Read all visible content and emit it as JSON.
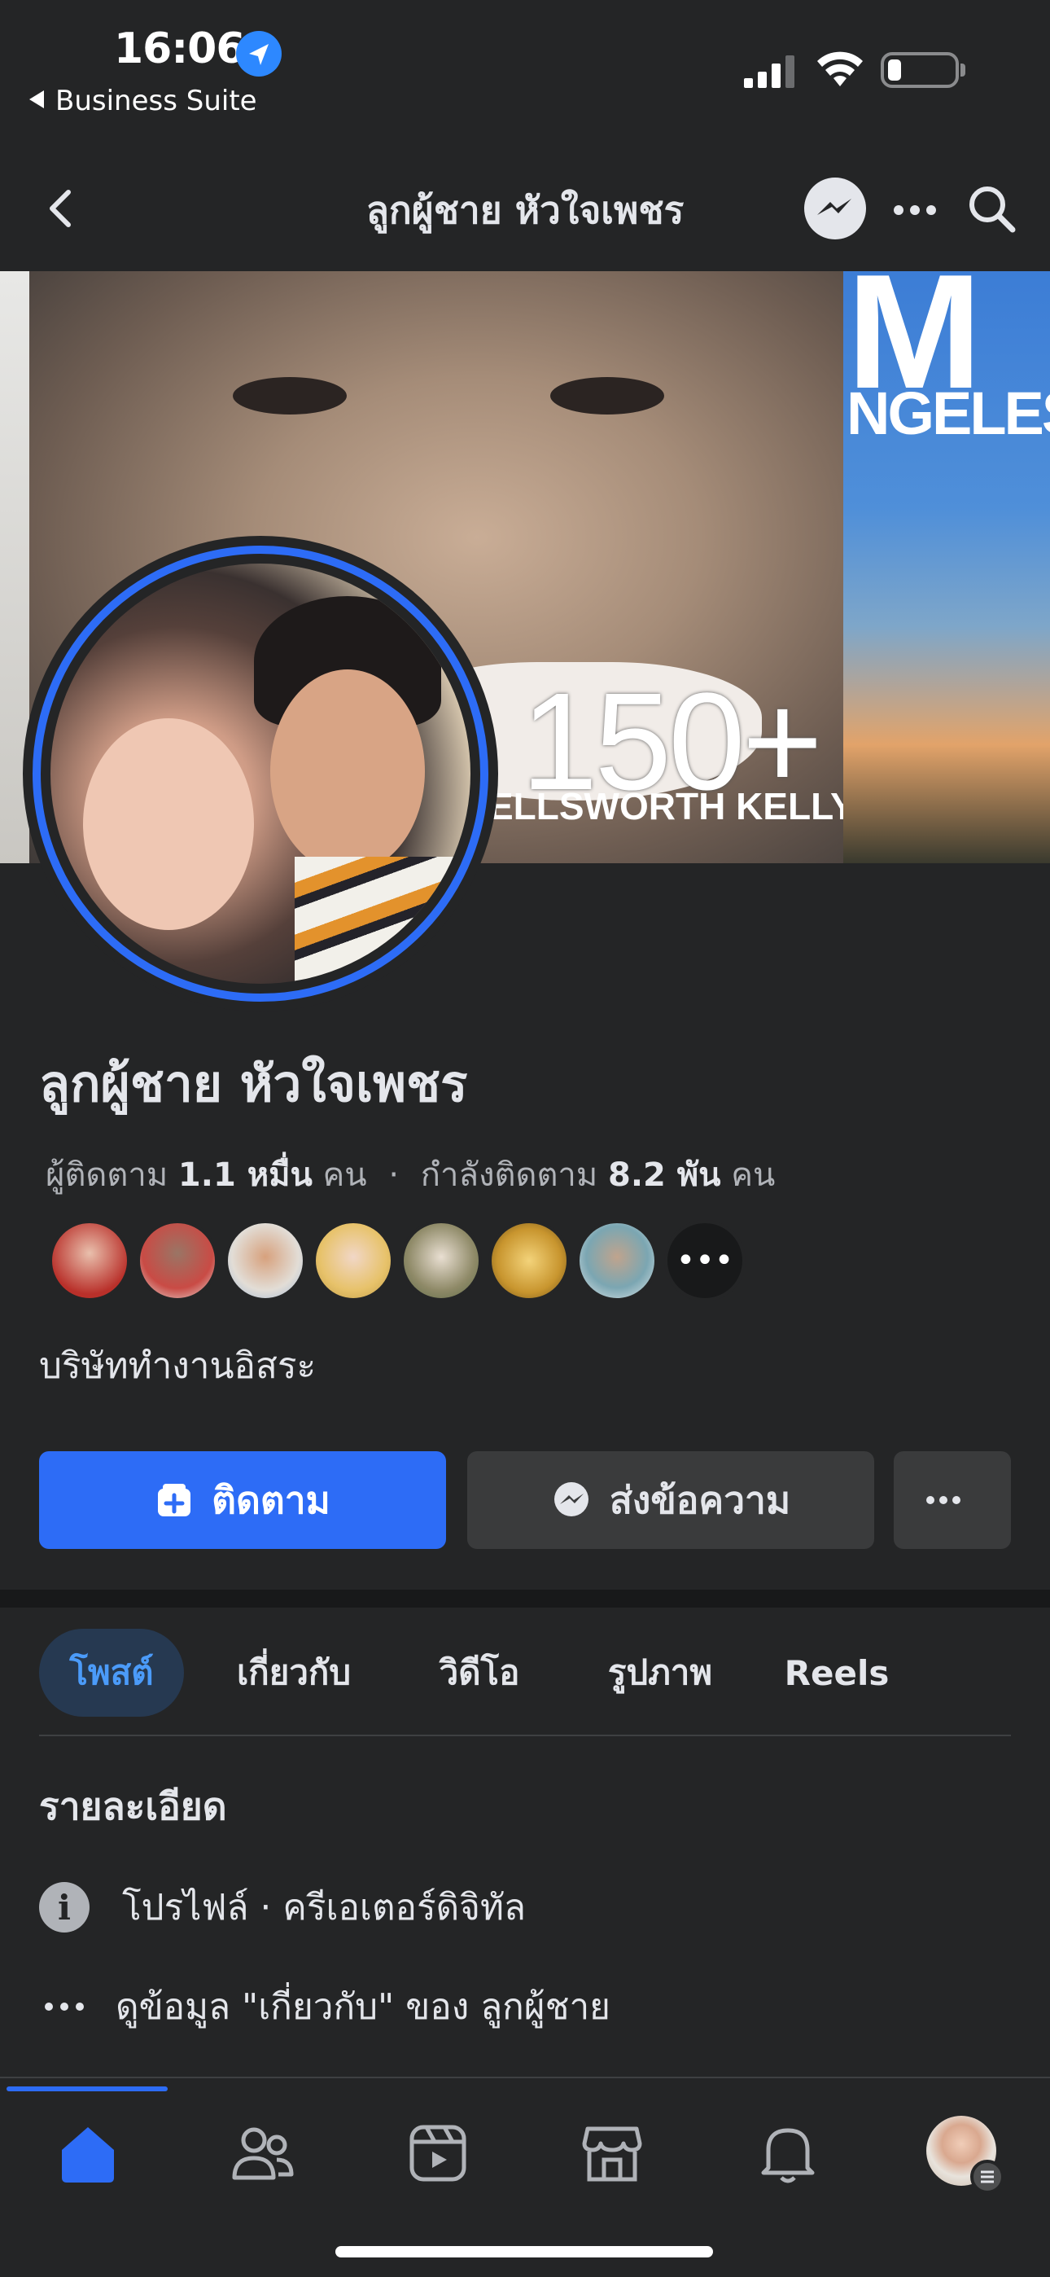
{
  "status_bar": {
    "time": "16:06",
    "back_app": "Business Suite",
    "icons": [
      "location-arrow-icon",
      "cellular-signal-icon",
      "wifi-icon",
      "battery-icon"
    ]
  },
  "nav": {
    "title": "ลูกผู้ชาย หัวใจเพชร",
    "icons": [
      "chevron-left-icon",
      "messenger-icon",
      "more-dots-icon",
      "search-icon"
    ]
  },
  "profile": {
    "name": "ลูกผู้ชาย หัวใจเพชร",
    "followers_label": "ผู้ติดตาม",
    "followers_value": "1.1 หมื่น",
    "followers_unit": "คน",
    "separator": "·",
    "following_label": "กำลังติดตาม",
    "following_value": "8.2 พัน",
    "following_unit": "คน",
    "follower_avatars_more": "•••",
    "bio": "บริษัททำงานอิสระ"
  },
  "cover": {
    "mag_big": "M",
    "mag_text": "NGELES",
    "number": "150+",
    "caption": "ELLSWORTH KELLY"
  },
  "actions": {
    "follow_label": "ติดตาม",
    "message_label": "ส่งข้อความ",
    "more_label": "•••"
  },
  "tabs": [
    {
      "label": "โพสต์",
      "active": true
    },
    {
      "label": "เกี่ยวกับ",
      "active": false
    },
    {
      "label": "วิดีโอ",
      "active": false
    },
    {
      "label": "รูปภาพ",
      "active": false
    },
    {
      "label": "Reels",
      "active": false
    }
  ],
  "details": {
    "title": "รายละเอียด",
    "profile_row": "โปรไฟล์ · ครีเอเตอร์ดิจิทัล",
    "about_row": "ดูข้อมูล \"เกี่ยวกับ\" ของ ลูกผู้ชาย"
  },
  "tabbar": {
    "items": [
      "home-icon",
      "friends-icon",
      "video-icon",
      "marketplace-icon",
      "bell-icon",
      "profile-avatar"
    ],
    "active": "home-icon"
  },
  "colors": {
    "background": "#242526",
    "accent": "#2d6cf6",
    "secondary_button": "#3a3b3c",
    "text_primary": "#e4e6eb",
    "text_secondary": "#b0b3b8"
  }
}
